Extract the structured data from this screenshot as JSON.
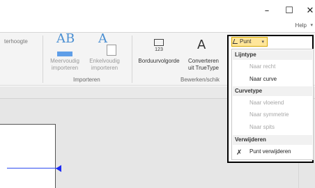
{
  "window": {
    "minimize": "–",
    "maximize": "☐",
    "close": "✕"
  },
  "ribbon": {
    "help": "Help",
    "partial_left_label": "terhoogte",
    "importeren": {
      "group_label": "Importeren",
      "meervoudig_line1": "Meervoudig",
      "meervoudig_line2": "importeren",
      "enkelvoudig_line1": "Enkelvoudig",
      "enkelvoudig_line2": "importeren"
    },
    "bewerken": {
      "group_label": "Bewerken/schik",
      "borduurvolgorde": "Borduurvolgorde",
      "converteren_line1": "Converteren",
      "converteren_line2": "uit TrueType"
    }
  },
  "dropdown": {
    "button_label": "Punt",
    "sections": [
      {
        "header": "Lijntype",
        "items": [
          {
            "label": "Naar recht",
            "disabled": true
          },
          {
            "label": "Naar curve",
            "disabled": false
          }
        ]
      },
      {
        "header": "Curvetype",
        "items": [
          {
            "label": "Naar vloeiend",
            "disabled": true
          },
          {
            "label": "Naar symmetrie",
            "disabled": true
          },
          {
            "label": "Naar spits",
            "disabled": true
          }
        ]
      },
      {
        "header": "Verwijderen",
        "items": [
          {
            "label": "Punt verwijderen",
            "disabled": false
          }
        ]
      }
    ]
  }
}
